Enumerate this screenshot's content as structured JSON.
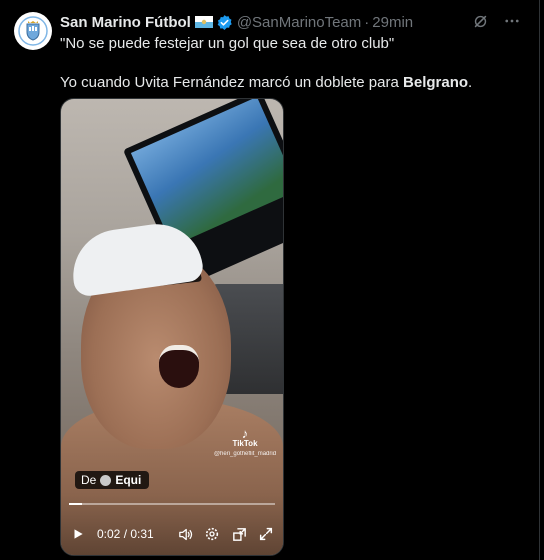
{
  "tweet": {
    "author_name": "San Marino Fútbol",
    "handle": "@SanMarinoTeam",
    "separator": "·",
    "time": "29min",
    "text_line1": "\"No se puede festejar un gol que sea de otro club\"",
    "text_line2_prefix": "Yo cuando Uvita Fernández marcó un doblete para ",
    "text_line2_bold": "Belgrano",
    "text_line2_suffix": "."
  },
  "icons": {
    "avatar": "san-marino-crest-icon",
    "flag": "san-marino-flag-icon",
    "verified": "verified-badge-icon",
    "grok": "grok-icon",
    "more": "more-icon"
  },
  "video": {
    "credit_prefix": "De",
    "credit_name": "Equi",
    "watermark_brand": "TikTok",
    "watermark_user": "@heri_gotheflit_madrid",
    "current_time": "0:02",
    "time_separator": " / ",
    "duration": "0:31",
    "progress": 0.065
  },
  "colors": {
    "background": "#000000",
    "text": "#e7e9ea",
    "muted": "#71767b",
    "verified": "#1d9bf0"
  }
}
